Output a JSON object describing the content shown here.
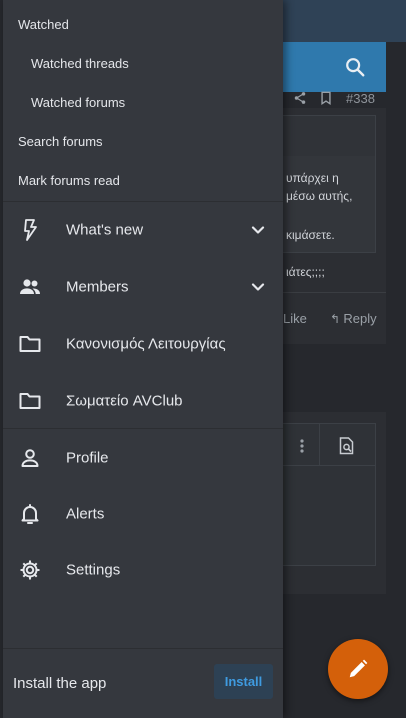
{
  "drawer": {
    "sub_items": [
      {
        "label": "Watched"
      },
      {
        "label": "Watched threads"
      },
      {
        "label": "Watched forums"
      },
      {
        "label": "Search forums"
      },
      {
        "label": "Mark forums read"
      }
    ],
    "nav_items": [
      {
        "label": "What's new",
        "icon": "bolt-icon",
        "expandable": true
      },
      {
        "label": "Members",
        "icon": "members-icon",
        "expandable": true
      },
      {
        "label": "Κανονισμός Λειτουργίας",
        "icon": "folder-icon"
      },
      {
        "label": "Σωματείο AVClub",
        "icon": "folder-icon"
      }
    ],
    "account_items": [
      {
        "label": "Profile",
        "icon": "user-icon"
      },
      {
        "label": "Alerts",
        "icon": "bell-icon"
      },
      {
        "label": "Settings",
        "icon": "gear-icon"
      }
    ],
    "install": {
      "text": "Install the app",
      "button_label": "Install"
    }
  },
  "background": {
    "post_number": "#338",
    "post_text": [
      "υπάρχει η",
      "μέσω αυτής,",
      "κιμάσετε.",
      "ιάτες;;;;"
    ],
    "like_label": "Like",
    "reply_label": "Reply"
  },
  "colors": {
    "drawer_bg": "#35383e",
    "page_bg": "#26282d",
    "header_blue": "#2f79ad",
    "accent_link": "#3f9be0",
    "fab": "#d4600a"
  }
}
